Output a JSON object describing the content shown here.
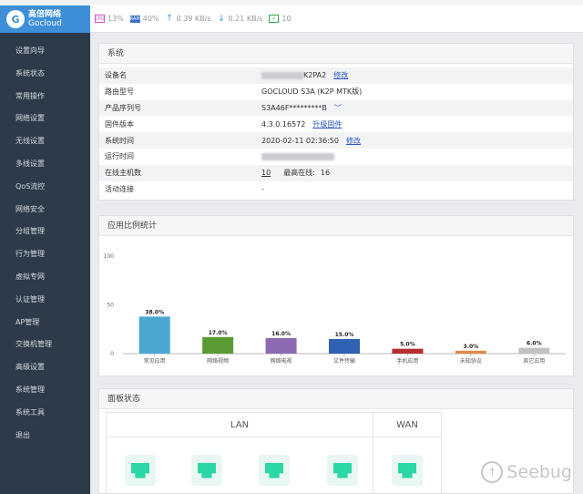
{
  "logo": {
    "glyph": "G",
    "name_cn": "高倍网络",
    "name_en": "Gocloud"
  },
  "sidebar": {
    "items": [
      {
        "label": "设置向导"
      },
      {
        "label": "系统状态"
      },
      {
        "label": "常用操作"
      },
      {
        "label": "网络设置"
      },
      {
        "label": "无线设置"
      },
      {
        "label": "多线设置"
      },
      {
        "label": "QoS流控"
      },
      {
        "label": "网络安全"
      },
      {
        "label": "分组管理"
      },
      {
        "label": "行为管理"
      },
      {
        "label": "虚拟专网"
      },
      {
        "label": "认证管理"
      },
      {
        "label": "AP管理"
      },
      {
        "label": "交换机管理"
      },
      {
        "label": "高级设置"
      },
      {
        "label": "系统管理"
      },
      {
        "label": "系统工具"
      },
      {
        "label": "退出"
      }
    ]
  },
  "topbar": {
    "cpu": {
      "icon": "cpu-icon",
      "value": "13%"
    },
    "ram": {
      "icon": "ram-icon",
      "value": "40%"
    },
    "upload": {
      "icon": "upload-arrow-icon",
      "value": "0.39 KB/s"
    },
    "download": {
      "icon": "download-arrow-icon",
      "value": "0.21 KB/s"
    },
    "hosts": {
      "icon": "host-monitor-icon",
      "value": "10"
    }
  },
  "system": {
    "title": "系统",
    "rows": {
      "device_name": {
        "label": "设备名",
        "value": "K2PA2",
        "action": "修改"
      },
      "model": {
        "label": "路由型号",
        "value": "GOCLOUD S3A (K2P MTK版)"
      },
      "serial": {
        "label": "产品序列号",
        "value": "S3A46F*********B"
      },
      "firmware": {
        "label": "固件版本",
        "value": "4.3.0.16572",
        "action": "升级固件"
      },
      "time": {
        "label": "系统时间",
        "value": "2020-02-11 02:36:50",
        "action": "修改"
      },
      "uptime": {
        "label": "运行时间",
        "value": ""
      },
      "online": {
        "label": "在线主机数",
        "value": "10",
        "peak_label": "最高在线:",
        "peak_value": "16"
      },
      "connections": {
        "label": "活动连接",
        "value": "-"
      }
    }
  },
  "chart_panel": {
    "title": "应用比例统计"
  },
  "chart_data": {
    "type": "bar",
    "categories": [
      "常见应用",
      "网络视频",
      "网络电视",
      "文件传输",
      "手机应用",
      "未知协议",
      "其它应用"
    ],
    "values": [
      38.0,
      17.0,
      16.0,
      15.0,
      5.0,
      3.0,
      6.0
    ],
    "value_labels": [
      "38.0%",
      "17.0%",
      "16.0%",
      "15.0%",
      "5.0%",
      "3.0%",
      "6.0%"
    ],
    "colors": [
      "#4aa8d0",
      "#5a9a33",
      "#8c6ab2",
      "#2f62b3",
      "#b3302f",
      "#e08848",
      "#c2c2c2"
    ],
    "yticks": [
      0,
      50,
      100
    ],
    "ylim": [
      0,
      100
    ],
    "grid": false
  },
  "board": {
    "title": "面板状态",
    "lan_label": "LAN",
    "wan_label": "WAN",
    "port_icon": "ethernet-port-icon"
  },
  "watermark": {
    "text": "Seebug"
  }
}
